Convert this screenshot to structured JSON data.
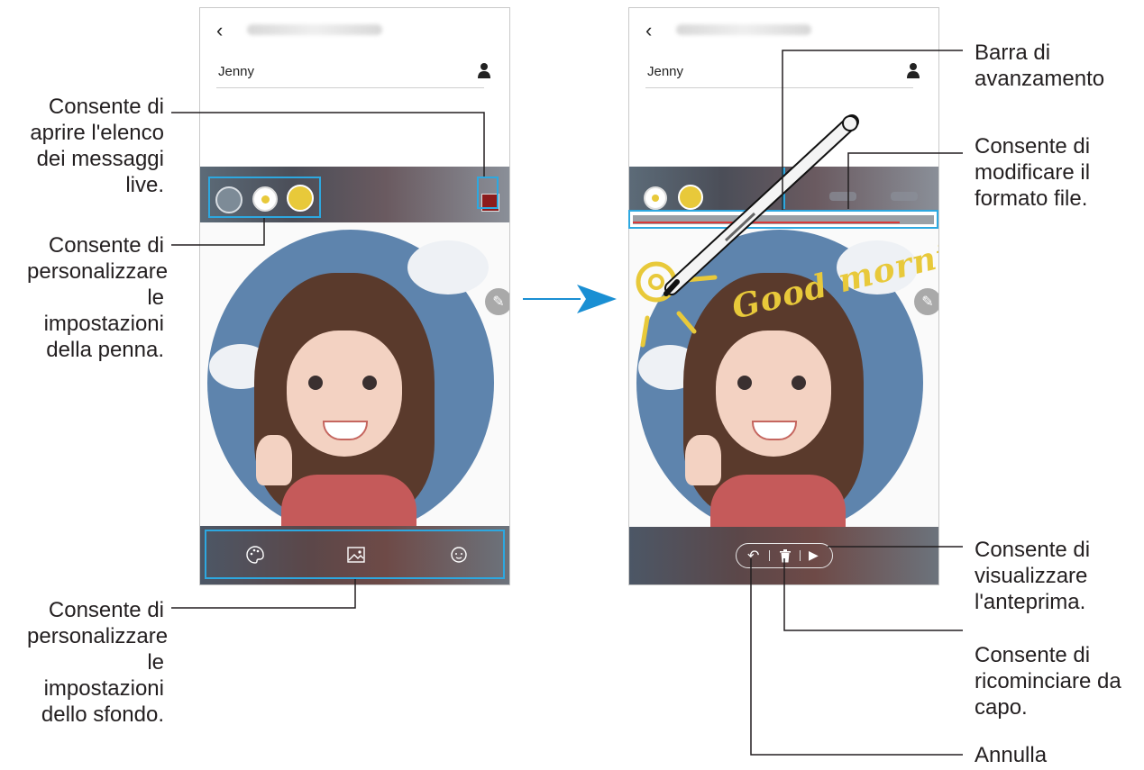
{
  "left_phone": {
    "recipient": "Jenny"
  },
  "right_phone": {
    "recipient": "Jenny"
  },
  "callouts": {
    "live_list": "Consente di aprire l'elenco dei messaggi live.",
    "pen_settings": "Consente di personalizzare le impostazioni della penna.",
    "background_settings": "Consente di personalizzare le impostazioni dello sfondo.",
    "progress_bar": "Barra di avanzamento",
    "file_format": "Consente di modificare il formato file.",
    "preview": "Consente di visualizzare l'anteprima.",
    "restart": "Consente di ricominciare da capo.",
    "undo": "Annulla"
  },
  "handwriting": "Good morning!",
  "icons": [
    "back-icon",
    "person-icon",
    "sticker-icon",
    "pen-color-icon",
    "live-message-list-icon",
    "palette-icon",
    "image-icon",
    "avatar-icon",
    "edit-icon",
    "undo-icon",
    "trash-icon",
    "play-icon"
  ],
  "colors": {
    "highlight": "#2da8e0",
    "pen_yellow": "#e8c93a",
    "sky": "#5e84ad",
    "arrow": "#1a8fd3"
  }
}
